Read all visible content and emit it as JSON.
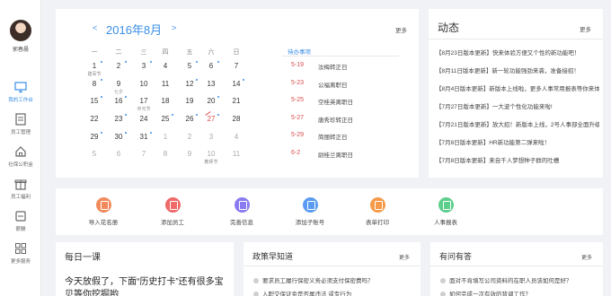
{
  "user": {
    "name": "郭春晨"
  },
  "sidebar": {
    "items": [
      {
        "label": "我的工作台",
        "icon": "monitor-icon"
      },
      {
        "label": "员工管理",
        "icon": "id-card-icon"
      },
      {
        "label": "社保公积金",
        "icon": "house-icon"
      },
      {
        "label": "员工福利",
        "icon": "gift-icon"
      },
      {
        "label": "薪酬",
        "icon": "wallet-icon"
      },
      {
        "label": "更多服务",
        "icon": "grid-icon"
      }
    ]
  },
  "calendar": {
    "prev": "<",
    "next": ">",
    "month_label": "2016年8月",
    "more": "更多",
    "weekdays": [
      "一",
      "二",
      "三",
      "四",
      "五",
      "六",
      "日"
    ],
    "rows": [
      [
        {
          "d": "1",
          "dot": true,
          "sub": "建军节"
        },
        {
          "d": "2",
          "dot": true
        },
        {
          "d": "3",
          "dot": true
        },
        {
          "d": "4"
        },
        {
          "d": "5",
          "dot": true
        },
        {
          "d": "6",
          "dot": true
        },
        {
          "d": "7"
        }
      ],
      [
        {
          "d": "8",
          "dot": true
        },
        {
          "d": "9",
          "sub": "七夕"
        },
        {
          "d": "10"
        },
        {
          "d": "11"
        },
        {
          "d": "12",
          "dot": true
        },
        {
          "d": "13"
        },
        {
          "d": "14",
          "dot": true
        }
      ],
      [
        {
          "d": "15",
          "dot": true
        },
        {
          "d": "16",
          "dot": true
        },
        {
          "d": "17",
          "sub": "中元节"
        },
        {
          "d": "18"
        },
        {
          "d": "19"
        },
        {
          "d": "20",
          "dot": true
        },
        {
          "d": "21"
        }
      ],
      [
        {
          "d": "22"
        },
        {
          "d": "23",
          "dot": true
        },
        {
          "d": "24"
        },
        {
          "d": "25",
          "dot": true
        },
        {
          "d": "26",
          "dot": true
        },
        {
          "d": "27",
          "dot": true,
          "today": true
        },
        {
          "d": "28"
        }
      ],
      [
        {
          "d": "29",
          "dot": true
        },
        {
          "d": "30",
          "dot": true
        },
        {
          "d": "31",
          "dot": true
        },
        {
          "d": "1",
          "muted": true
        },
        {
          "d": "2",
          "muted": true
        },
        {
          "d": "3",
          "muted": true
        },
        {
          "d": "4",
          "muted": true
        }
      ],
      [
        {
          "d": "5",
          "muted": true
        },
        {
          "d": "6",
          "muted": true
        },
        {
          "d": "7",
          "muted": true
        },
        {
          "d": "8",
          "muted": true
        },
        {
          "d": "9",
          "muted": true
        },
        {
          "d": "10",
          "muted": true,
          "sub": "教师节"
        },
        {
          "d": "11",
          "muted": true
        }
      ]
    ],
    "todo_title": "待办事项",
    "todos": [
      {
        "date": "5-19",
        "text": "汝梅转正日"
      },
      {
        "date": "5-23",
        "text": "公福离职日"
      },
      {
        "date": "5-25",
        "text": "空桂英离职日"
      },
      {
        "date": "5-27",
        "text": "唐秀珍转正日"
      },
      {
        "date": "5-29",
        "text": "简丽转正日"
      },
      {
        "date": "6-2",
        "text": "尉桂兰离职日"
      }
    ]
  },
  "news": {
    "title": "动态",
    "more": "更多",
    "items": [
      "【8月23日版本更新】快来体验方便又个性的新功能吧！",
      "【8月11日版本更新】新一轮功能强劲来袭，准备接招！",
      "【8月4日版本更新】新版本上线啦，更多人事常用报表等你来体验",
      "【7月27日版本更新】一大波个性化功能来啦!",
      "【7月21日版本更新】放大招！新版本上线，2号人事部全面升级",
      "【7月8日版本更新】HR新功能第二弹来啦！",
      "【7月8日版本更新】来自千人梦想种子群的吐槽"
    ]
  },
  "quick": {
    "items": [
      {
        "label": "导入花名册",
        "color": "#f28a5c",
        "icon": "import-icon"
      },
      {
        "label": "添加员工",
        "color": "#f06a6a",
        "icon": "add-user-icon"
      },
      {
        "label": "完善信息",
        "color": "#8a7cf0",
        "icon": "info-icon"
      },
      {
        "label": "添加子账号",
        "color": "#5b9cf2",
        "icon": "sub-account-icon"
      },
      {
        "label": "表单打印",
        "color": "#f49a48",
        "icon": "print-icon"
      },
      {
        "label": "人事报表",
        "color": "#5ccf8c",
        "icon": "report-icon"
      }
    ]
  },
  "lesson": {
    "title": "每日一课",
    "text": "今天放假了，下面“历史打卡”还有很多宝贝等你挖掘哟"
  },
  "policy": {
    "title": "政策早知道",
    "more": "更多",
    "items": [
      "要求员工履行保密义务必须支付保密费吗？",
      "入职交保证金是否属违法 或专行为"
    ]
  },
  "qa": {
    "title": "有问有答",
    "more": "更多",
    "items": [
      "面对不肯填写公司资料的在职人员该如何是好？",
      "如何完成一次有效的背调工作？"
    ]
  }
}
